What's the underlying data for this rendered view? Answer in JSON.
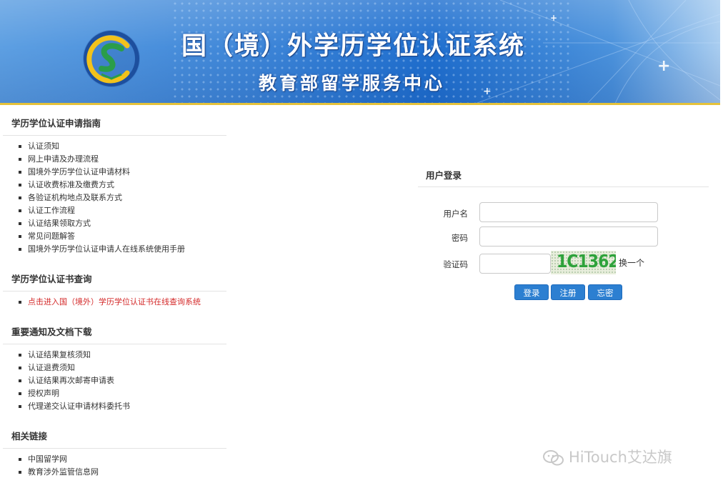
{
  "banner": {
    "title": "国（境）外学历学位认证系统",
    "subtitle": "教育部留学服务中心"
  },
  "sidebar": {
    "sections": [
      {
        "title": "学历学位认证申请指南",
        "items": [
          {
            "label": "认证须知"
          },
          {
            "label": "网上申请及办理流程"
          },
          {
            "label": "国境外学历学位认证申请材料"
          },
          {
            "label": "认证收费标准及缴费方式"
          },
          {
            "label": "各验证机构地点及联系方式"
          },
          {
            "label": "认证工作流程"
          },
          {
            "label": "认证结果领取方式"
          },
          {
            "label": "常见问题解答"
          },
          {
            "label": "国境外学历学位认证申请人在线系统使用手册"
          }
        ]
      },
      {
        "title": "学历学位认证书查询",
        "items": [
          {
            "label": "点击进入国（境外）学历学位认证书在线查询系统"
          }
        ]
      },
      {
        "title": "重要通知及文档下载",
        "items": [
          {
            "label": "认证结果复核须知"
          },
          {
            "label": "认证退费须知"
          },
          {
            "label": "认证结果再次邮寄申请表"
          },
          {
            "label": "授权声明"
          },
          {
            "label": "代理递交认证申请材料委托书"
          }
        ]
      },
      {
        "title": "相关链接",
        "items": [
          {
            "label": "中国留学网"
          },
          {
            "label": "教育涉外监管信息网"
          }
        ]
      }
    ]
  },
  "login": {
    "title": "用户登录",
    "username_label": "用户名",
    "username_value": "",
    "password_label": "密码",
    "password_value": "",
    "captcha_label": "验证码",
    "captcha_value": "",
    "captcha_text": "1C1362",
    "refresh_label": "换一个",
    "login_button": "登录",
    "register_button": "注册",
    "forgot_button": "忘密"
  },
  "watermark": {
    "text": "HiTouch艾达旗"
  },
  "colors": {
    "link_red": "#d42a2a",
    "button_blue": "#2c7fd1",
    "banner_blue": "#1f6fcf",
    "banner_accent": "#e5c23a"
  }
}
